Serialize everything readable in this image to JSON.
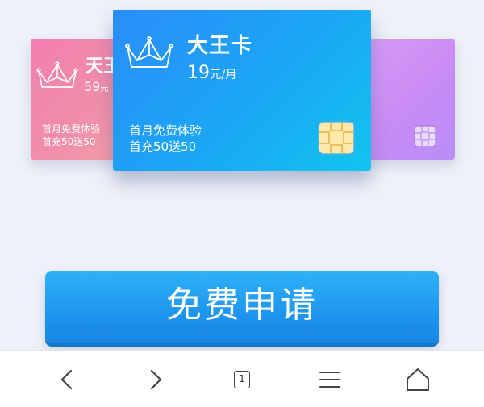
{
  "carousel": {
    "cards": [
      {
        "name": "天王",
        "price": "59",
        "price_unit": "元",
        "promo_line1": "首月免费体验",
        "promo_line2": "首充50送50"
      },
      {
        "name": "大王卡",
        "price": "19",
        "price_unit": "元/月",
        "promo_line1": "首月免费体验",
        "promo_line2": "首充50送50"
      },
      {
        "name": "",
        "price": "",
        "price_unit": "",
        "promo_line1": "",
        "promo_line2": ""
      }
    ]
  },
  "apply_button": {
    "label": "免费申请"
  },
  "browser_bar": {
    "tab_count": "1"
  },
  "colors": {
    "page_background": "#eef1f8",
    "center_card": "#1aa7f5",
    "left_card": "#f08fa9",
    "right_card": "#c88cf5",
    "apply_button": "#1e95ee"
  },
  "icons": {
    "crown": "crown-icon",
    "sim_chip": "sim-chip-icon",
    "back": "chevron-left-icon",
    "forward": "chevron-right-icon",
    "tabs": "tabs-icon",
    "menu": "menu-icon",
    "home": "home-icon"
  }
}
